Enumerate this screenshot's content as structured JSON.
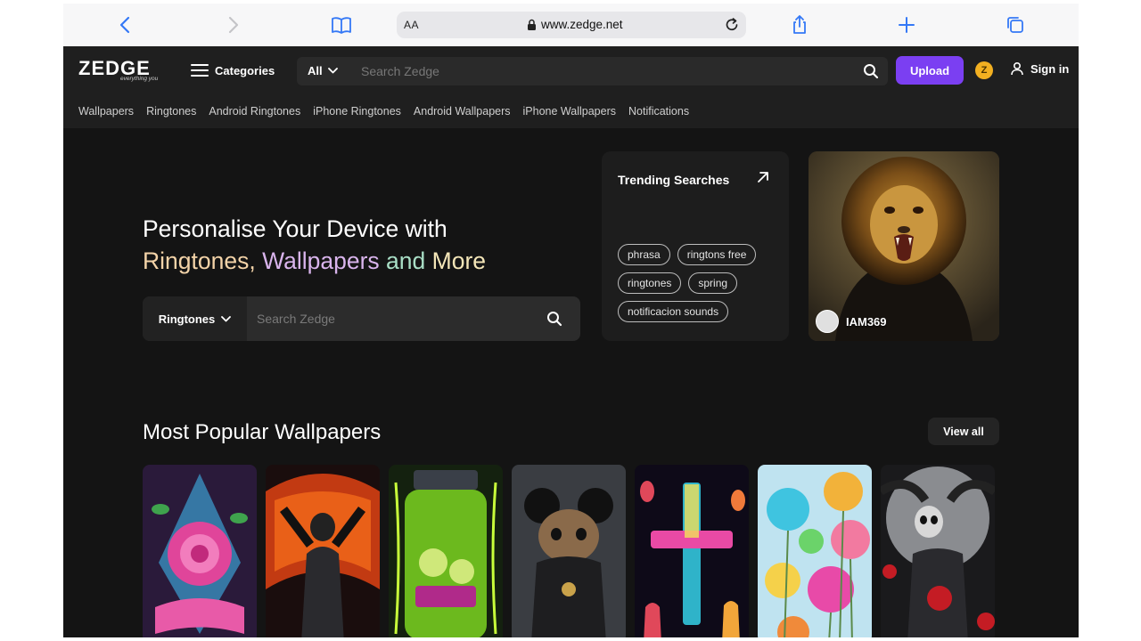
{
  "browser": {
    "text_size_label": "AA",
    "url": "www.zedge.net"
  },
  "header": {
    "logo_text": "ZEDGE",
    "logo_tagline": "everything you",
    "categories_label": "Categories",
    "search_scope": "All",
    "search_placeholder": "Search Zedge",
    "upload_label": "Upload",
    "coin_label": "Z",
    "signin_label": "Sign in"
  },
  "subnav": [
    "Wallpapers",
    "Ringtones",
    "Android Ringtones",
    "iPhone Ringtones",
    "Android Wallpapers",
    "iPhone Wallpapers",
    "Notifications"
  ],
  "hero": {
    "title_line1": "Personalise Your Device with",
    "title_ringtones": "Ringtones,",
    "title_wallpapers": "Wallpapers",
    "title_and_more": "and More",
    "search_type": "Ringtones",
    "search_placeholder": "Search Zedge"
  },
  "trending": {
    "title": "Trending Searches",
    "chips": [
      "phrasa",
      "ringtons free",
      "ringtones",
      "spring",
      "notificacion sounds"
    ]
  },
  "featured": {
    "username": "IAM369"
  },
  "popular": {
    "title": "Most Popular Wallpapers",
    "view_all_label": "View all"
  },
  "colors": {
    "accent_purple": "#7b3ff2",
    "background": "#141414",
    "header_bg": "#1f1f1f",
    "coin": "#f2b021"
  }
}
